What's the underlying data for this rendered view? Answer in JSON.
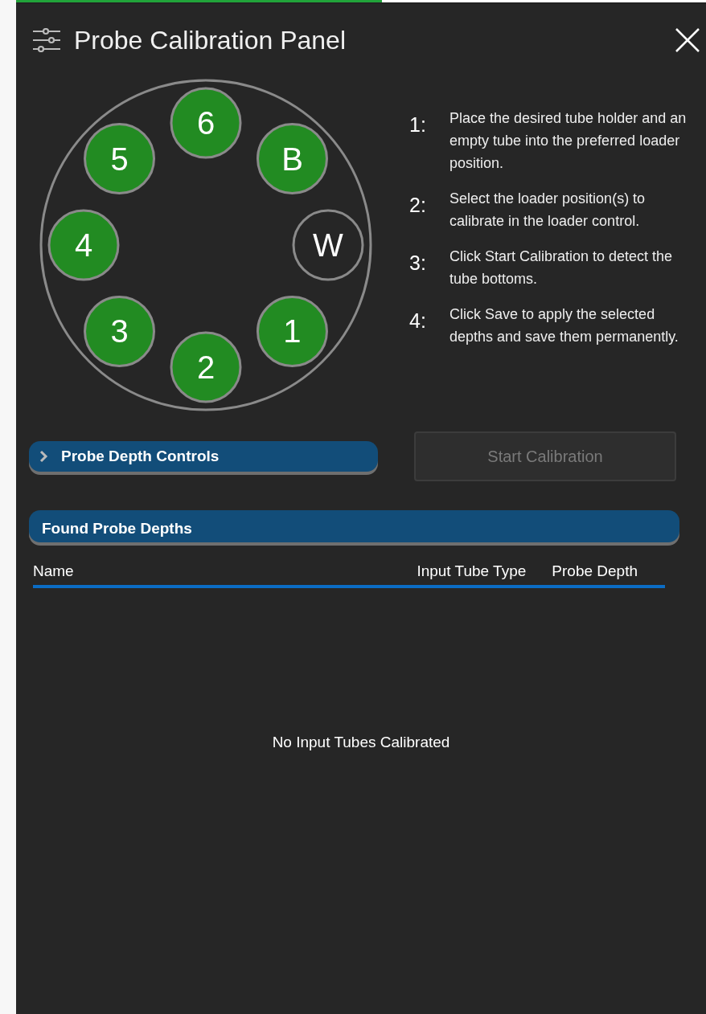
{
  "progress": {
    "level": 0.53
  },
  "window": {
    "title": "Probe Calibration Panel"
  },
  "loader": {
    "positions": [
      {
        "label": "6",
        "selected": true
      },
      {
        "label": "B",
        "selected": true
      },
      {
        "label": "W",
        "selected": false
      },
      {
        "label": "1",
        "selected": true
      },
      {
        "label": "2",
        "selected": true
      },
      {
        "label": "3",
        "selected": true
      },
      {
        "label": "4",
        "selected": true
      },
      {
        "label": "5",
        "selected": true
      }
    ]
  },
  "instructions": [
    {
      "number": "1:",
      "text": "Place the desired tube holder and an empty tube into the preferred loader position."
    },
    {
      "number": "2:",
      "text": "Select the loader position(s) to calibrate in the loader control."
    },
    {
      "number": "3:",
      "text": "Click Start Calibration to detect the tube bottoms."
    },
    {
      "number": "4:",
      "text": "Click Save to apply the selected depths and save them permanently."
    }
  ],
  "depth_controls": {
    "label": "Probe Depth Controls",
    "expanded": false
  },
  "start_button": {
    "label": "Start Calibration",
    "disabled": true
  },
  "found_depths": {
    "title": "Found Probe Depths",
    "columns": [
      "Name",
      "Input Tube Type",
      "Probe Depth"
    ],
    "empty_message": "No Input Tubes Calibrated"
  }
}
